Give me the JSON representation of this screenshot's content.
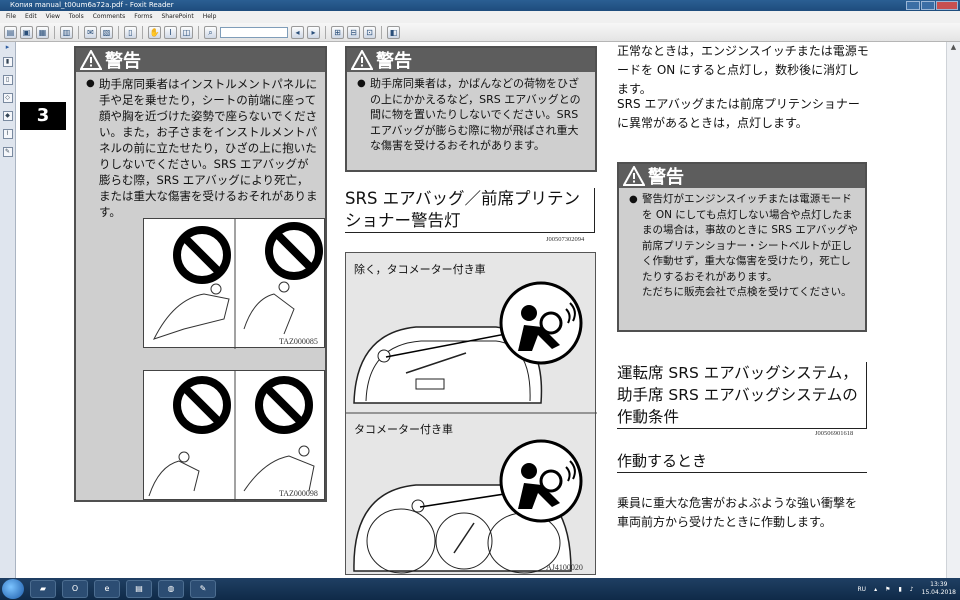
{
  "window": {
    "title": "Копия manual_t00um6a72a.pdf - Foxit Reader"
  },
  "menu": [
    "File",
    "Edit",
    "View",
    "Tools",
    "Comments",
    "Forms",
    "SharePoint",
    "Help"
  ],
  "chapter": "3",
  "warning_label": "警告",
  "col1": {
    "warning_text": "助手席同乗者はインストルメントパネルに手や足を乗せたり，シートの前端に座って顔や胸を近づけた姿勢で座らないでください。また，お子さまをインストルメントパネルの前に立たせたり，ひざの上に抱いたりしないでください。SRS エアバッグが膨らむ際，SRS エアバッグにより死亡，または重大な傷害を受けるおそれがあります。",
    "image_code_1": "TAZ000085",
    "image_code_2": "TAZ000098"
  },
  "col2": {
    "warning_text": "助手席同乗者は，かばんなどの荷物をひざの上にかかえるなど，SRS エアバッグとの間に物を置いたりしないでください。SRS エアバッグが膨らむ際に物が飛ばされ重大な傷害を受けるおそれがあります。",
    "heading": "SRS エアバッグ／前席プリテンショナー警告灯",
    "heading_code": "J00507302094",
    "panel_label_1": "除く，タコメーター付き車",
    "panel_label_2": "タコメーター付き車",
    "panel_code": "AJ4100020"
  },
  "col3": {
    "para1": "正常なときは，エンジンスイッチまたは電源モードを ON にすると点灯し，数秒後に消灯します。",
    "para2": "SRS エアバッグまたは前席プリテンショナーに異常があるときは，点灯します。",
    "warning_text": "警告灯がエンジンスイッチまたは電源モードを ON にしても点灯しない場合や点灯したままの場合は，事故のときに SRS エアバッグや前席プリテンショナー・シートベルトが正しく作動せず，重大な傷害を受けたり，死亡したりするおそれがあります。",
    "warning_text2": "ただちに販売会社で点検を受けてください。",
    "heading": "運転席 SRS エアバッグシステム，助手席 SRS エアバッグシステムの作動条件",
    "heading_code": "J00506901618",
    "subheading": "作動するとき",
    "para3": "乗員に重大な危害がおよぶような強い衝撃を車両前方から受けたときに作動します。"
  },
  "taskbar": {
    "lang": "RU",
    "time": "13:39",
    "date": "15.04.2018"
  },
  "colors": {
    "warn_head": "#5d5d5d",
    "warn_body": "#cfcfcf",
    "titlebar": "#1e4c7d"
  }
}
